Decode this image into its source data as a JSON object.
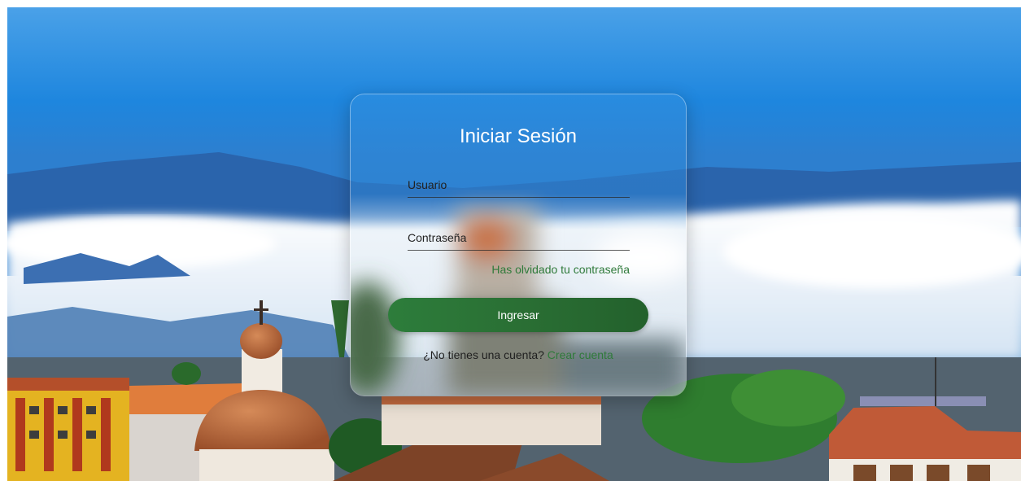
{
  "login": {
    "title": "Iniciar Sesión",
    "username_placeholder": "Usuario",
    "password_placeholder": "Contraseña",
    "forgot_link": "Has olvidado tu contraseña",
    "submit_label": "Ingresar",
    "signup_prompt": "¿No tienes una cuenta?",
    "signup_link": "Crear cuenta"
  },
  "colors": {
    "accent_green": "#2d7d3b",
    "link_green": "#2f7a3a",
    "title_text": "#ffffff"
  }
}
